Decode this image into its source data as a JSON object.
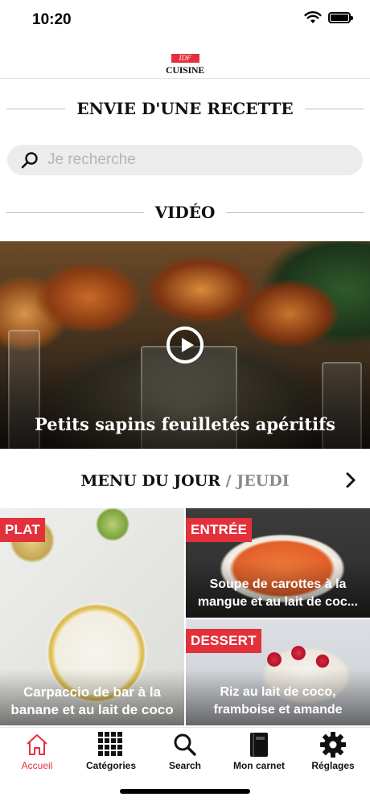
{
  "status_bar": {
    "time": "10:20",
    "icons": [
      "wifi-icon",
      "battery-icon"
    ]
  },
  "header": {
    "logo": {
      "top": "IDF",
      "bottom": "CUISINE"
    }
  },
  "recipe_section": {
    "title": "ENVIE D'UNE RECETTE",
    "search": {
      "placeholder": "Je recherche",
      "value": ""
    }
  },
  "video_section": {
    "title": "VIDÉO",
    "video": {
      "title": "Petits sapins feuilletés apéritifs"
    }
  },
  "menu_section": {
    "title": "MENU DU JOUR",
    "separator": " / ",
    "day": "JEUDI",
    "cards": [
      {
        "badge": "PLAT",
        "title": "Carpaccio de bar à la banane et au lait de coco"
      },
      {
        "badge": "ENTRÉE",
        "title": "Soupe de carottes à la mangue et au lait de coc..."
      },
      {
        "badge": "DESSERT",
        "title": "Riz au lait de coco, framboise et amande"
      }
    ]
  },
  "tab_bar": {
    "active": "Accueil",
    "tabs": [
      {
        "label": "Accueil",
        "icon": "home-icon"
      },
      {
        "label": "Catégories",
        "icon": "grid-icon"
      },
      {
        "label": "Search",
        "icon": "search-icon"
      },
      {
        "label": "Mon carnet",
        "icon": "notebook-icon"
      },
      {
        "label": "Réglages",
        "icon": "gear-icon"
      }
    ]
  },
  "colors": {
    "accent": "#e3313c",
    "search_background": "#ececec",
    "day_label": "#8a8a8a"
  }
}
